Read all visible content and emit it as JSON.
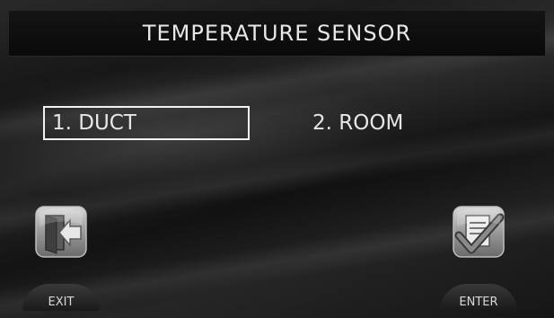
{
  "header": {
    "title": "TEMPERATURE SENSOR"
  },
  "options": [
    {
      "label": "1. DUCT",
      "selected": true
    },
    {
      "label": "2. ROOM",
      "selected": false
    }
  ],
  "buttons": {
    "exit": {
      "label": "EXIT",
      "icon": "exit-door-icon"
    },
    "enter": {
      "label": "ENTER",
      "icon": "checklist-check-icon"
    }
  }
}
